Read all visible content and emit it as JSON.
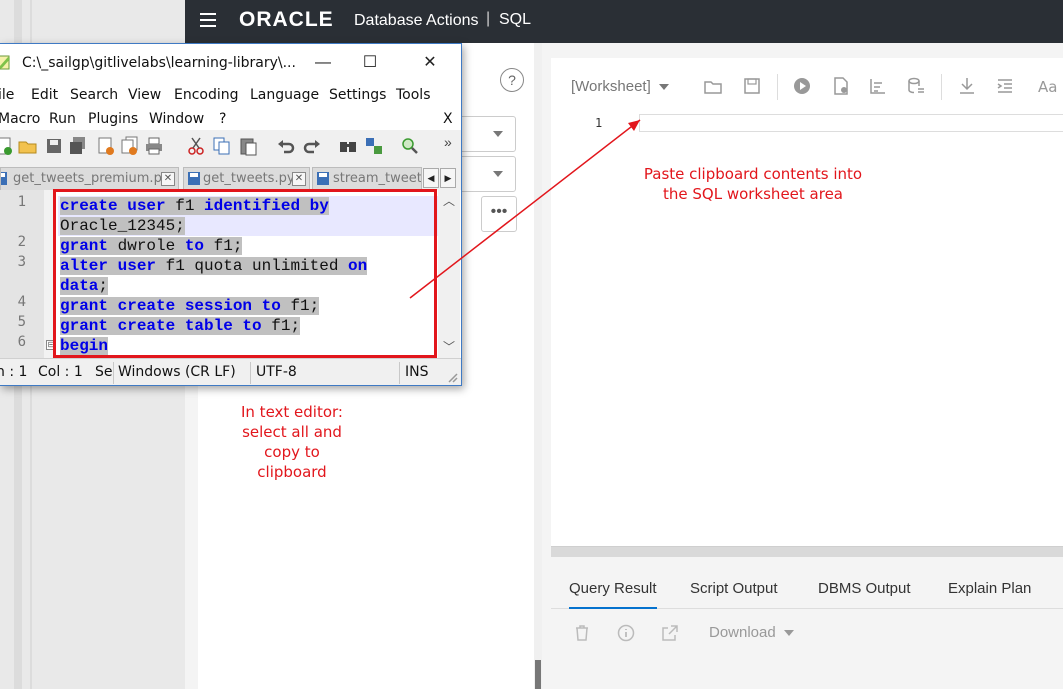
{
  "oracle": {
    "brand": "ORACLE",
    "app_name": "Database Actions",
    "separator": "|",
    "section": "SQL",
    "help_symbol": "?",
    "more_symbol": "•••",
    "worksheet_label": "[Worksheet]",
    "editor_line_number": "1",
    "result_tabs": [
      "Query Result",
      "Script Output",
      "DBMS Output",
      "Explain Plan"
    ],
    "download_label": "Download",
    "header_bg": "#2a2f35"
  },
  "notepad": {
    "title": "C:\\_sailgp\\gitlivelabs\\learning-library\\...",
    "controls": {
      "minimize": "—",
      "maximize": "☐",
      "close": "✕"
    },
    "menu_row1": [
      "ile",
      "Edit",
      "Search",
      "View",
      "Encoding",
      "Language",
      "Settings",
      "Tools"
    ],
    "menu_row2": [
      "Macro",
      "Run",
      "Plugins",
      "Window",
      "?"
    ],
    "menu_close": "X",
    "tabs": [
      "get_tweets_premium.py",
      "get_tweets.py",
      "stream_tweets"
    ],
    "tab_close": "✕",
    "tab_left": "◀",
    "tab_right": "▶",
    "toolbar_more": "»",
    "line_numbers": [
      "1",
      "2",
      "3",
      "4",
      "5",
      "6"
    ],
    "fold_marker": "⊟",
    "code_lines": [
      [
        {
          "t": "create user",
          "k": 1
        },
        {
          "t": " f1 ",
          "k": 0
        },
        {
          "t": "identified by",
          "k": 1
        }
      ],
      [
        {
          "t": "Oracle_12345;",
          "k": 0
        }
      ],
      [
        {
          "t": "grant",
          "k": 1
        },
        {
          "t": " dwrole ",
          "k": 0
        },
        {
          "t": "to",
          "k": 1
        },
        {
          "t": " f1;",
          "k": 0
        }
      ],
      [
        {
          "t": "alter user",
          "k": 1
        },
        {
          "t": " f1 quota unlimited ",
          "k": 0
        },
        {
          "t": "on",
          "k": 1
        }
      ],
      [
        {
          "t": "data",
          "k": 1
        },
        {
          "t": ";",
          "k": 0
        }
      ],
      [
        {
          "t": "grant create session to",
          "k": 1
        },
        {
          "t": " f1;",
          "k": 0
        }
      ],
      [
        {
          "t": "grant create table to",
          "k": 1
        },
        {
          "t": " f1;",
          "k": 0
        }
      ],
      [
        {
          "t": "begin",
          "k": 1
        }
      ]
    ],
    "status": {
      "ln": "n : 1",
      "col": "Col : 1",
      "se": "Se",
      "eol": "Windows (CR LF)",
      "encoding": "UTF-8",
      "mode": "INS"
    },
    "keyword_color": "#0000e8",
    "selection_color": "#c0c0c0"
  },
  "annotations": {
    "paste_line1": "Paste clipboard contents into",
    "paste_line2": "the SQL worksheet area",
    "editor_line1": "In text editor:",
    "editor_line2": "select all and",
    "editor_line3": "copy to",
    "editor_line4": "clipboard",
    "color": "#e2161c"
  }
}
